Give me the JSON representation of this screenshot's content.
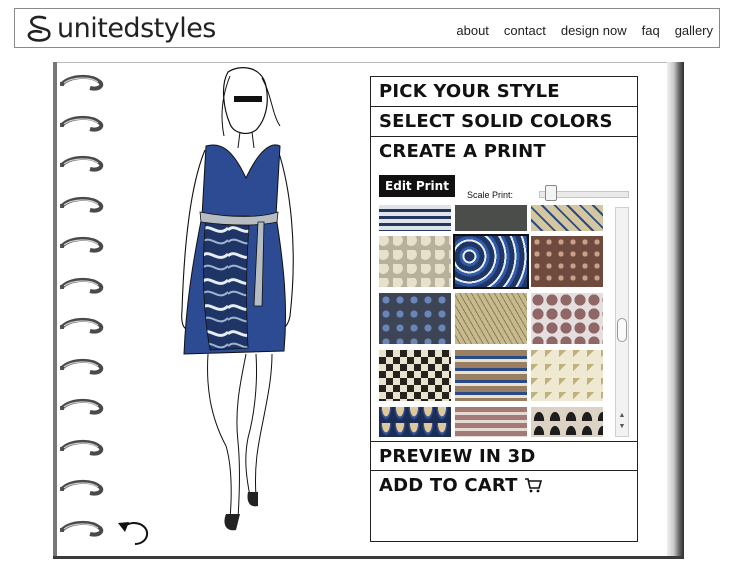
{
  "header": {
    "logo_text": "unitedstyles",
    "nav": [
      "about",
      "contact",
      "design now",
      "faq",
      "gallery"
    ]
  },
  "panel": {
    "sections": {
      "pick_style": "PICK YOUR STYLE",
      "solid_colors": "SELECT SOLID COLORS",
      "create_print": "CREATE A PRINT",
      "preview": "PREVIEW IN 3D",
      "add_to_cart": "ADD TO CART"
    },
    "edit_print_label": "Edit Print",
    "scale_label": "Scale Print:",
    "scale_value": 0.06,
    "prints": [
      {
        "name": "navy-stripes",
        "base": "#dfe3ea",
        "accent": "#24365e"
      },
      {
        "name": "charcoal-solid",
        "base": "#4b4d4a",
        "accent": "#5d5f5b"
      },
      {
        "name": "tan-diamond",
        "base": "#d4c7a0",
        "accent": "#2c4b86"
      },
      {
        "name": "cream-crackle",
        "base": "#e6e1cc",
        "accent": "#b8b09a"
      },
      {
        "name": "blue-swirl",
        "base": "#1f3566",
        "accent": "#e6edf3"
      },
      {
        "name": "brown-mosaic",
        "base": "#6f4a3f",
        "accent": "#c9a08a"
      },
      {
        "name": "navy-dots",
        "base": "#3c4456",
        "accent": "#6a85b8"
      },
      {
        "name": "khaki-squiggle",
        "base": "#c7ba8e",
        "accent": "#8b7d57"
      },
      {
        "name": "mauve-hex",
        "base": "#8f6767",
        "accent": "#e5dede"
      },
      {
        "name": "black-checks",
        "base": "#26231f",
        "accent": "#e8e2cf"
      },
      {
        "name": "rust-bands",
        "base": "#9a7f62",
        "accent": "#2a4c86"
      },
      {
        "name": "beige-triangles",
        "base": "#efe9d2",
        "accent": "#c0b07a"
      },
      {
        "name": "peacock-scale",
        "base": "#3c5fa1",
        "accent": "#e0c89a"
      },
      {
        "name": "mauve-waves",
        "base": "#a27a78",
        "accent": "#e7d9d1"
      },
      {
        "name": "ink-scallop",
        "base": "#dcd3c4",
        "accent": "#1e1e1e"
      }
    ],
    "selected_print": "blue-swirl"
  },
  "colors": {
    "dress": "#2c4b92",
    "belt": "#b5bdc2"
  }
}
